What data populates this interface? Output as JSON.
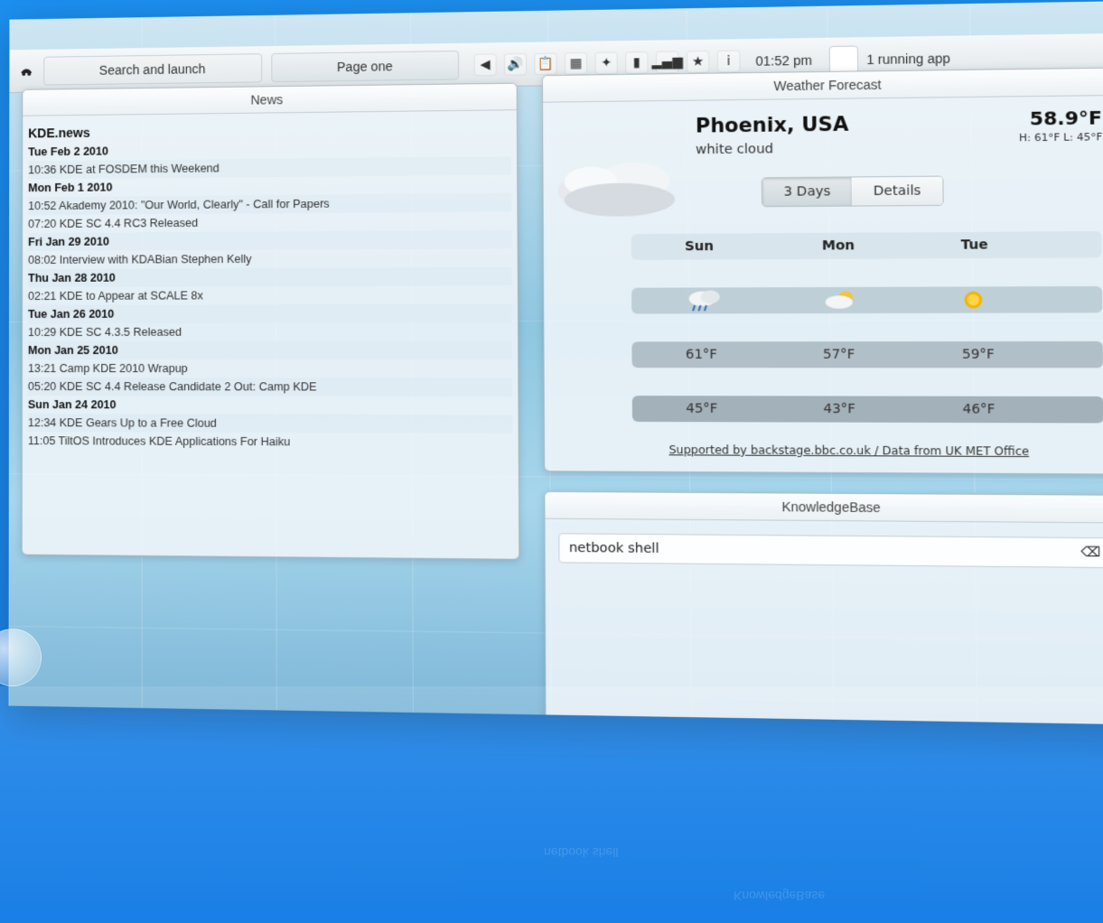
{
  "topbar": {
    "search_label": "Search and launch",
    "page_label": "Page one",
    "clock": "01:52 pm",
    "running_apps_label": "1 running app",
    "tray_icons": [
      "volume-icon",
      "speaker-icon",
      "clipboard-icon",
      "network-icon",
      "app-icon",
      "battery-icon",
      "signal-icon",
      "star-icon",
      "info-icon"
    ]
  },
  "news": {
    "title": "News",
    "feed": "KDE.news",
    "items": [
      {
        "type": "head",
        "text": "Tue Feb 2 2010"
      },
      {
        "type": "item",
        "text": "10:36 KDE at FOSDEM this Weekend"
      },
      {
        "type": "head",
        "text": "Mon Feb 1 2010"
      },
      {
        "type": "item",
        "text": "10:52 Akademy 2010: \"Our World, Clearly\" - Call for Papers"
      },
      {
        "type": "item",
        "text": "07:20 KDE SC 4.4 RC3 Released"
      },
      {
        "type": "head",
        "text": "Fri Jan 29 2010"
      },
      {
        "type": "item",
        "text": "08:02 Interview with KDABian Stephen Kelly"
      },
      {
        "type": "head",
        "text": "Thu Jan 28 2010"
      },
      {
        "type": "item",
        "text": "02:21 KDE to Appear at SCALE 8x"
      },
      {
        "type": "head",
        "text": "Tue Jan 26 2010"
      },
      {
        "type": "item",
        "text": "10:29 KDE SC 4.3.5 Released"
      },
      {
        "type": "head",
        "text": "Mon Jan 25 2010"
      },
      {
        "type": "item",
        "text": "13:21 Camp KDE 2010 Wrapup"
      },
      {
        "type": "item",
        "text": "05:20 KDE SC 4.4 Release Candidate 2 Out: Camp KDE"
      },
      {
        "type": "head",
        "text": "Sun Jan 24 2010"
      },
      {
        "type": "item",
        "text": "12:34 KDE Gears Up to a Free Cloud"
      },
      {
        "type": "item",
        "text": "11:05 TiltOS Introduces KDE Applications For Haiku"
      }
    ]
  },
  "weather": {
    "title": "Weather Forecast",
    "location": "Phoenix, USA",
    "condition": "white cloud",
    "current_temp": "58.9°F",
    "hilo": "H: 61°F L: 45°F",
    "tabs": [
      "3 Days",
      "Details"
    ],
    "active_tab": "3 Days",
    "days": [
      "Sun",
      "Mon",
      "Tue"
    ],
    "highs": [
      "61°F",
      "57°F",
      "59°F"
    ],
    "lows": [
      "45°F",
      "43°F",
      "46°F"
    ],
    "day_icons": [
      "rain-cloud-icon",
      "partly-sunny-icon",
      "sun-icon"
    ],
    "credit": "Supported by backstage.bbc.co.uk / Data from UK MET Office"
  },
  "kb": {
    "title": "KnowledgeBase",
    "query": "netbook shell"
  },
  "reflection": {
    "kb_title_reflection": "KnowledgeBase",
    "kb_query_reflection": "netbook shell"
  }
}
